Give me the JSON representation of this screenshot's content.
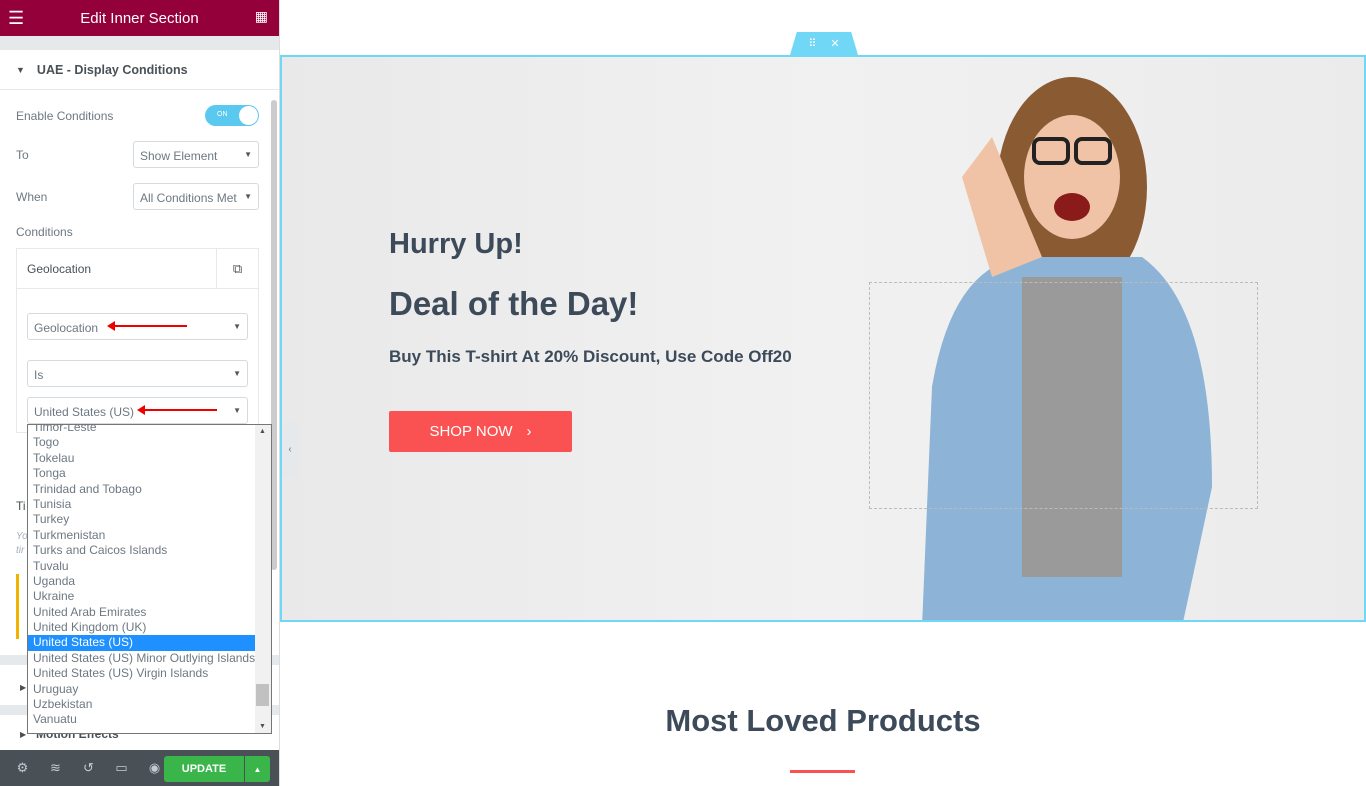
{
  "header": {
    "title": "Edit Inner Section",
    "menu_icon": "hamburger-icon",
    "apps_icon": "grid-icon"
  },
  "section": {
    "title": "UAE - Display Conditions",
    "enable_label": "Enable Conditions",
    "toggle_label": "ON",
    "toggle_on": true,
    "to_label": "To",
    "to_value": "Show Element",
    "when_label": "When",
    "when_value": "All Conditions Met",
    "conditions_label": "Conditions",
    "repeater_title": "Geolocation",
    "rule_value": "Geolocation",
    "operator_value": "Is",
    "country_value": "United States (US)"
  },
  "hidden_fragments": {
    "ti": "Ti",
    "yo": "Yo",
    "tir": "tir",
    "motion": "Motion Effects"
  },
  "dropdown": {
    "options": [
      "Timor-Leste",
      "Togo",
      "Tokelau",
      "Tonga",
      "Trinidad and Tobago",
      "Tunisia",
      "Turkey",
      "Turkmenistan",
      "Turks and Caicos Islands",
      "Tuvalu",
      "Uganda",
      "Ukraine",
      "United Arab Emirates",
      "United Kingdom (UK)",
      "United States (US)",
      "United States (US) Minor Outlying Islands",
      "United States (US) Virgin Islands",
      "Uruguay",
      "Uzbekistan",
      "Vanuatu"
    ],
    "selected": "United States (US)"
  },
  "footer": {
    "update_label": "UPDATE",
    "icons": [
      "gear-icon",
      "layers-icon",
      "history-icon",
      "responsive-icon",
      "eye-icon"
    ]
  },
  "canvas": {
    "hurry": "Hurry Up!",
    "deal": "Deal of the Day!",
    "subtitle": "Buy This T-shirt At 20% Discount, Use Code Off20",
    "shop_label": "SHOP NOW",
    "products_title": "Most Loved Products"
  },
  "colors": {
    "header": "#93003a",
    "accent": "#71d7f7",
    "button": "#fa5252",
    "update": "#39b54a",
    "selected": "#1e90ff"
  }
}
